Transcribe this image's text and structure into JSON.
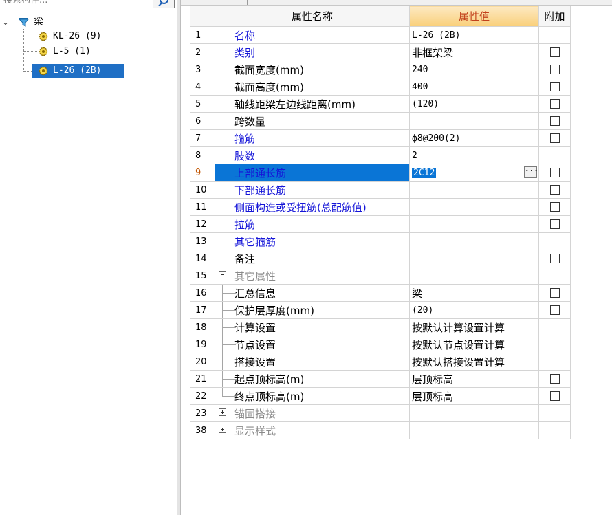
{
  "search": {
    "placeholder": "搜索构件..."
  },
  "tree": {
    "root": {
      "label": "梁",
      "expander": "⌄"
    },
    "children": [
      {
        "label": "KL-26 (9)",
        "selected": false
      },
      {
        "label": "L-5 (1)",
        "selected": false
      },
      {
        "label": "L-26 (2B)",
        "selected": true
      }
    ]
  },
  "grid": {
    "headers": {
      "name": "属性名称",
      "value": "属性值",
      "extra": "附加"
    },
    "rows": [
      {
        "num": "1",
        "name": "名称",
        "value": "L-26 (2B)",
        "name_color": "blue",
        "checkbox": false,
        "value_font": "mono"
      },
      {
        "num": "2",
        "name": "类别",
        "value": "非框架梁",
        "name_color": "blue",
        "checkbox": true,
        "value_font": "cjk"
      },
      {
        "num": "3",
        "name": "截面宽度(mm)",
        "value": "240",
        "name_color": "black",
        "checkbox": true,
        "value_font": "mono"
      },
      {
        "num": "4",
        "name": "截面高度(mm)",
        "value": "400",
        "name_color": "black",
        "checkbox": true,
        "value_font": "mono"
      },
      {
        "num": "5",
        "name": "轴线距梁左边线距离(mm)",
        "value": "(120)",
        "name_color": "black",
        "checkbox": true,
        "value_font": "mono"
      },
      {
        "num": "6",
        "name": "跨数量",
        "value": "",
        "name_color": "black",
        "checkbox": true,
        "value_font": "mono"
      },
      {
        "num": "7",
        "name": "箍筋",
        "value": "ф8@200(2)",
        "name_color": "blue",
        "checkbox": true,
        "value_font": "mono"
      },
      {
        "num": "8",
        "name": "肢数",
        "value": "2",
        "name_color": "blue",
        "checkbox": false,
        "value_font": "mono"
      },
      {
        "num": "9",
        "name": "上部通长筋",
        "value": "2C12",
        "name_color": "blue",
        "checkbox": true,
        "value_font": "mono",
        "selected": true,
        "ellipsis": "···"
      },
      {
        "num": "10",
        "name": "下部通长筋",
        "value": "",
        "name_color": "blue",
        "checkbox": true,
        "value_font": "mono"
      },
      {
        "num": "11",
        "name": "侧面构造或受扭筋(总配筋值)",
        "value": "",
        "name_color": "blue",
        "checkbox": true,
        "value_font": "mono"
      },
      {
        "num": "12",
        "name": "拉筋",
        "value": "",
        "name_color": "blue",
        "checkbox": true,
        "value_font": "mono"
      },
      {
        "num": "13",
        "name": "其它箍筋",
        "value": "",
        "name_color": "blue",
        "checkbox": false,
        "value_font": "mono"
      },
      {
        "num": "14",
        "name": "备注",
        "value": "",
        "name_color": "black",
        "checkbox": true,
        "value_font": "mono"
      },
      {
        "num": "15",
        "name": "其它属性",
        "value": "",
        "name_color": "gray",
        "checkbox": false,
        "group": "minus"
      },
      {
        "num": "16",
        "name": "汇总信息",
        "value": "梁",
        "name_color": "black",
        "checkbox": true,
        "value_font": "cjk",
        "child": true
      },
      {
        "num": "17",
        "name": "保护层厚度(mm)",
        "value": "(20)",
        "name_color": "black",
        "checkbox": true,
        "value_font": "mono",
        "child": true
      },
      {
        "num": "18",
        "name": "计算设置",
        "value": "按默认计算设置计算",
        "name_color": "black",
        "checkbox": false,
        "value_font": "cjk",
        "child": true
      },
      {
        "num": "19",
        "name": "节点设置",
        "value": "按默认节点设置计算",
        "name_color": "black",
        "checkbox": false,
        "value_font": "cjk",
        "child": true
      },
      {
        "num": "20",
        "name": "搭接设置",
        "value": "按默认搭接设置计算",
        "name_color": "black",
        "checkbox": false,
        "value_font": "cjk",
        "child": true
      },
      {
        "num": "21",
        "name": "起点顶标高(m)",
        "value": "层顶标高",
        "name_color": "black",
        "checkbox": true,
        "value_font": "cjk",
        "child": true
      },
      {
        "num": "22",
        "name": "终点顶标高(m)",
        "value": "层顶标高",
        "name_color": "black",
        "checkbox": true,
        "value_font": "cjk",
        "child": true,
        "last_child": true
      },
      {
        "num": "23",
        "name": "锚固搭接",
        "value": "",
        "name_color": "gray",
        "checkbox": false,
        "group": "plus"
      },
      {
        "num": "38",
        "name": "显示样式",
        "value": "",
        "name_color": "gray",
        "checkbox": false,
        "group": "plus"
      }
    ]
  }
}
